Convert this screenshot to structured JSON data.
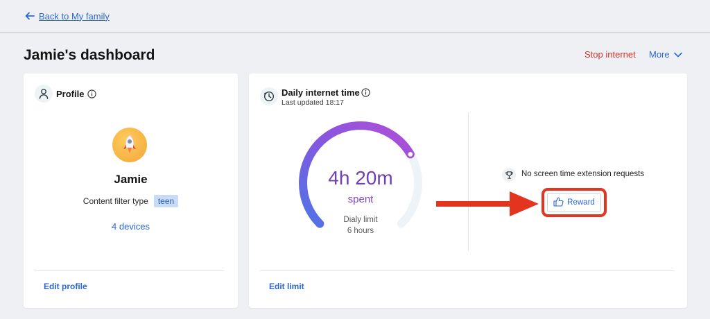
{
  "nav": {
    "back_label": "Back to My family"
  },
  "header": {
    "title": "Jamie's dashboard",
    "stop_internet": "Stop internet",
    "more": "More"
  },
  "profile": {
    "title": "Profile",
    "name": "Jamie",
    "filter_label": "Content filter type",
    "filter_value": "teen",
    "devices": "4 devices",
    "edit": "Edit profile"
  },
  "internet": {
    "title": "Daily internet time",
    "last_updated": "Last updated 18:17",
    "spent_value": "4h 20m",
    "spent_label": "spent",
    "limit_label": "Dialy limit",
    "limit_value": "6 hours",
    "usage_fraction": 0.722,
    "requests_text": "No screen time extension requests",
    "reward": "Reward",
    "edit": "Edit limit"
  },
  "icons": {
    "back": "arrow-left-icon",
    "more": "chevron-down-icon",
    "profile": "person-icon",
    "info": "info-icon",
    "clock": "clock-icon",
    "trophy": "trophy-icon",
    "thumbs_up": "thumbs-up-icon",
    "avatar": "rocket-icon",
    "annotation": "red-arrow-icon"
  },
  "colors": {
    "link": "#2a66d8",
    "danger": "#d0342c",
    "gauge_start": "#4f74e6",
    "gauge_end": "#b04fd8",
    "gauge_track": "#eef3f8",
    "annotation": "#e3341f"
  }
}
